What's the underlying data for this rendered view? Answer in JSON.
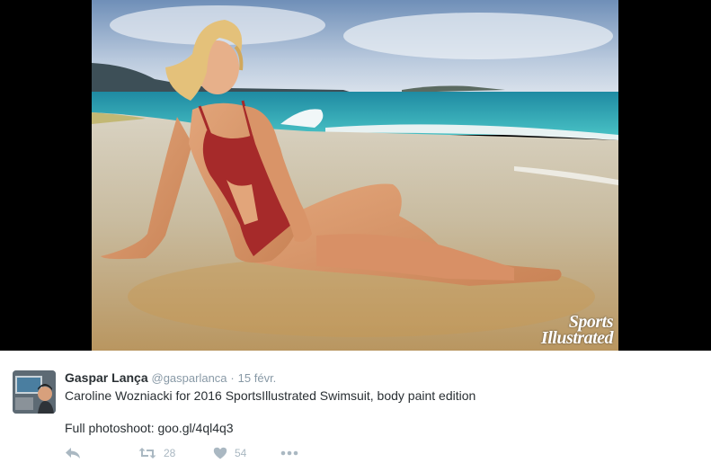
{
  "media": {
    "watermark_line1": "Sports",
    "watermark_line2": "Illustrated"
  },
  "tweet": {
    "author_name": "Gaspar Lança",
    "author_handle": "@gasparlanca",
    "separator": "·",
    "timestamp": "15 févr.",
    "text_line1": "Caroline Wozniacki for 2016 SportsIllustrated Swimsuit, body paint edition",
    "text_line2": "Full photoshoot: goo.gl/4ql4q3",
    "retweet_count": "28",
    "like_count": "54"
  },
  "colors": {
    "name": "#292f33",
    "meta": "#8899a6",
    "action": "#aab8c2"
  },
  "icons": {
    "reply": "reply-arrow-icon",
    "retweet": "retweet-icon",
    "like": "heart-icon",
    "more": "more-dots-icon"
  }
}
